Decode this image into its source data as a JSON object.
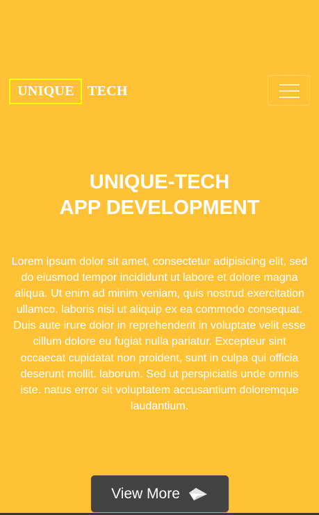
{
  "navbar": {
    "brand_boxed": "UNIQUE",
    "brand_tail": "TECH",
    "brand_box_color": "#FFFF00",
    "toggle_icon": "hamburger-menu-icon"
  },
  "hero": {
    "title_line1": "UNIQUE-TECH",
    "title_line2": "APP DEVELOPMENT",
    "body": "Lorem ipsum dolor sit amet, consectetur adipisicing elit, sed do eiusmod tempor incididunt ut labore et dolore magna aliqua. Ut enim ad minim veniam, quis nostrud exercitation ullamco. laboris nisi ut aliquip ex ea commodo consequat. Duis aute irure dolor in reprehenderit in voluptate velit esse cillum dolore eu fugiat nulla pariatur. Excepteur sint occaecat cupidatat non proident, sunt in culpa qui officia deserunt mollit. laborum. Sed ut perspiciatis unde omnis iste. natus error sit voluptatem accusantium doloremque laudantium.",
    "cta_label": "View More",
    "cta_icon": "paper-plane-icon"
  },
  "colors": {
    "background": "#FFC236",
    "button_bg": "#434343",
    "text": "#FFFFFF"
  }
}
